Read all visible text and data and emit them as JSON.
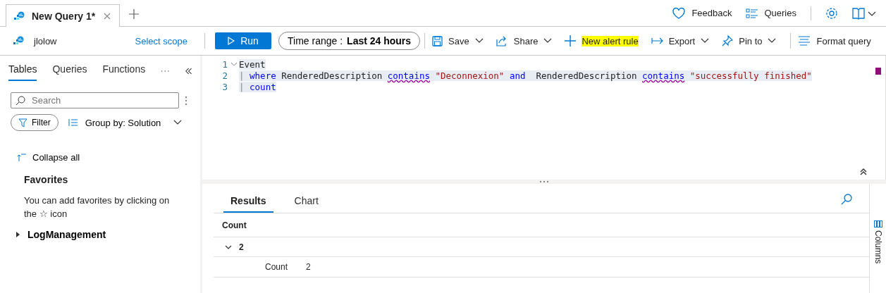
{
  "query_tabs": [
    {
      "label": "New Query 1*",
      "selected": true
    }
  ],
  "header_actions": [
    {
      "label": "Feedback",
      "kind": "heart"
    },
    {
      "label": "Queries",
      "kind": "list"
    }
  ],
  "workspace": {
    "name": "jlolow",
    "scope_link": "Select scope"
  },
  "toolbar": {
    "run": "Run",
    "time_range": {
      "label": "Time range :",
      "value": "Last 24 hours"
    },
    "actions": [
      {
        "label": "Save",
        "kind": "save",
        "dropdown": true,
        "highlighted": false
      },
      {
        "label": "Share",
        "kind": "share",
        "dropdown": true,
        "highlighted": false
      },
      {
        "label": "New alert rule",
        "kind": "plus",
        "dropdown": false,
        "highlighted": true
      },
      {
        "label": "Export",
        "kind": "export",
        "dropdown": true,
        "highlighted": false
      },
      {
        "label": "Pin to",
        "kind": "pin",
        "dropdown": true,
        "highlighted": false
      }
    ],
    "format": "Format query"
  },
  "sidebar": {
    "tabs": [
      {
        "label": "Tables",
        "selected": true
      },
      {
        "label": "Queries",
        "selected": false
      },
      {
        "label": "Functions",
        "selected": false
      }
    ],
    "search": {
      "placeholder": "Search"
    },
    "filter": "Filter",
    "group_by": "Group by: Solution",
    "collapse": "Collapse all",
    "favorites_title": "Favorites",
    "favorites_text": "You can add favorites by clicking on the ☆ icon",
    "tree": [
      {
        "label": "LogManagement",
        "expanded": false
      }
    ]
  },
  "editor": {
    "lines": [
      {
        "number": "1",
        "tokens": [
          {
            "kind": "plain",
            "text": "Event",
            "warning": false
          }
        ]
      },
      {
        "number": "2",
        "tokens": [
          {
            "kind": "pipe",
            "text": "|",
            "warning": false
          },
          {
            "kind": "keyword",
            "text": "where",
            "warning": false
          },
          {
            "kind": "plain",
            "text": "RenderedDescription",
            "warning": false
          },
          {
            "kind": "keyword",
            "text": "contains",
            "warning": true
          },
          {
            "kind": "string",
            "text": "\"Deconnexion\"",
            "warning": false
          },
          {
            "kind": "keyword",
            "text": "and",
            "warning": false
          },
          {
            "kind": "plain",
            "text": " RenderedDescription",
            "warning": false
          },
          {
            "kind": "keyword",
            "text": "contains",
            "warning": true
          },
          {
            "kind": "string",
            "text": "\"successfully finished\"",
            "warning": false
          }
        ]
      },
      {
        "number": "3",
        "tokens": [
          {
            "kind": "pipe",
            "text": "|",
            "warning": false
          },
          {
            "kind": "keyword",
            "text": "count",
            "warning": false
          }
        ]
      }
    ]
  },
  "results": {
    "tabs": [
      {
        "label": "Results",
        "selected": true
      },
      {
        "label": "Chart",
        "selected": false
      }
    ],
    "columns": [
      "Count"
    ],
    "groups": [
      {
        "value": "2",
        "expanded": true,
        "rows": [
          {
            "label": "Count",
            "value": "2"
          }
        ]
      }
    ],
    "side_panel": "Columns"
  }
}
